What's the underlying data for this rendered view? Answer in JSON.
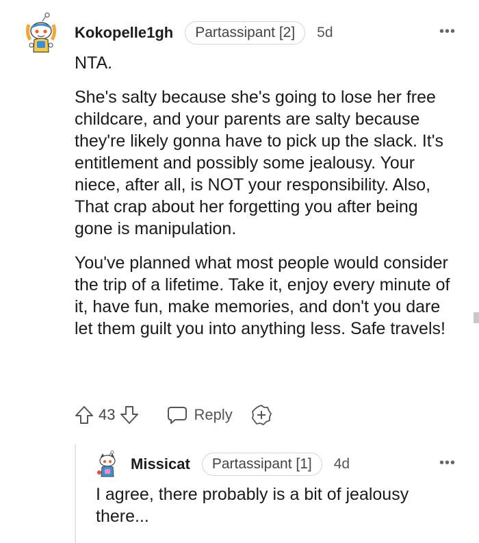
{
  "comment": {
    "username": "Kokopelle1gh",
    "flair": "Partassipant [2]",
    "time": "5d",
    "more": "•••",
    "paragraphs": [
      "NTA.",
      "She's salty because she's going to lose her free childcare, and your parents are salty because they're likely gonna have to pick up the slack. It's entitlement and possibly some jealousy. Your niece, after all, is NOT your responsibility. Also, That crap about her forgetting you after being gone is manipulation.",
      "You've planned what most people would consider the trip of a lifetime. Take it, enjoy every minute of it, have fun, make memories, and don't you dare let them guilt you into anything less. Safe travels!"
    ],
    "score": "43",
    "reply_label": "Reply"
  },
  "reply": {
    "username": "Missicat",
    "flair": "Partassipant [1]",
    "time": "4d",
    "more": "•••",
    "text": "I agree, there probably is a bit of jealousy there..."
  },
  "icons": {
    "upvote": "upvote-arrow-icon",
    "downvote": "downvote-arrow-icon",
    "reply": "speech-bubble-icon",
    "award": "add-award-icon",
    "more": "more-dots-icon"
  },
  "colors": {
    "text": "#1a1a1b",
    "muted": "#555555",
    "flair_border": "#d4d4d4",
    "thread_line": "#e6e6e6"
  }
}
